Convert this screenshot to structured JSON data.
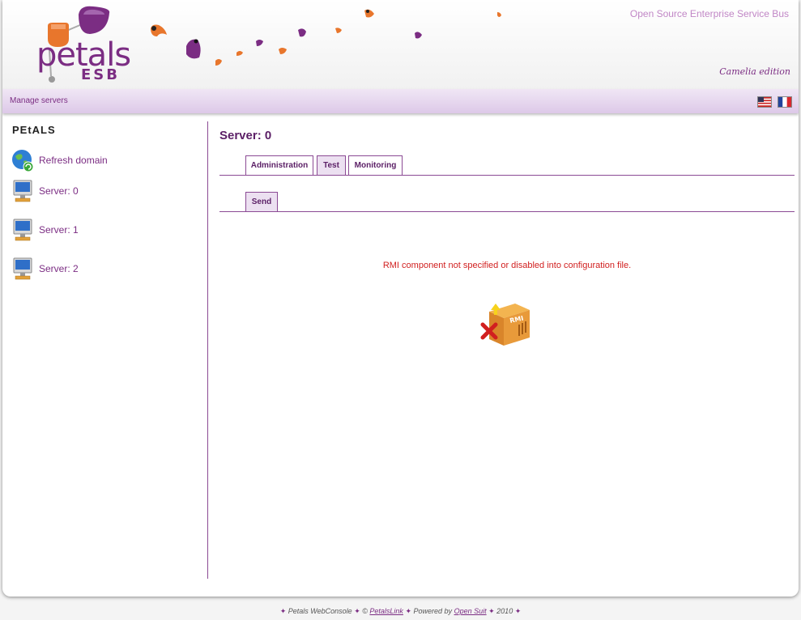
{
  "header": {
    "logo_word": "petals",
    "logo_sub": "ESB",
    "tagline": "Open Source Enterprise Service Bus",
    "edition": "Camelia edition"
  },
  "navbar": {
    "manage_link": "Manage servers",
    "languages": [
      "English",
      "French"
    ]
  },
  "sidebar": {
    "title": "PEtALS",
    "items": [
      {
        "label": "Refresh domain",
        "icon": "globe-refresh-icon"
      },
      {
        "label": "Server: 0",
        "icon": "server-icon"
      },
      {
        "label": "Server: 1",
        "icon": "server-icon"
      },
      {
        "label": "Server: 2",
        "icon": "server-icon"
      }
    ]
  },
  "main": {
    "title": "Server: 0",
    "tabs": [
      {
        "label": "Administration",
        "active": false
      },
      {
        "label": "Test",
        "active": true
      },
      {
        "label": "Monitoring",
        "active": false
      }
    ],
    "subtabs": [
      {
        "label": "Send",
        "active": true
      }
    ],
    "error_message": "RMI component not specified or disabled into configuration file.",
    "error_icon": "rmi-box-error-icon",
    "rmi_label": "RMI"
  },
  "footer": {
    "app_name": "Petals WebConsole",
    "copyright_symbol": "©",
    "company_link": "PetalsLink",
    "powered_by": "Powered by",
    "powered_link": "Open Suit",
    "year": "2010"
  },
  "colors": {
    "accent_purple": "#7b2d83",
    "navbar_bg": "#e6d6ee",
    "error_red": "#d11f1f",
    "orange": "#e8762c"
  }
}
